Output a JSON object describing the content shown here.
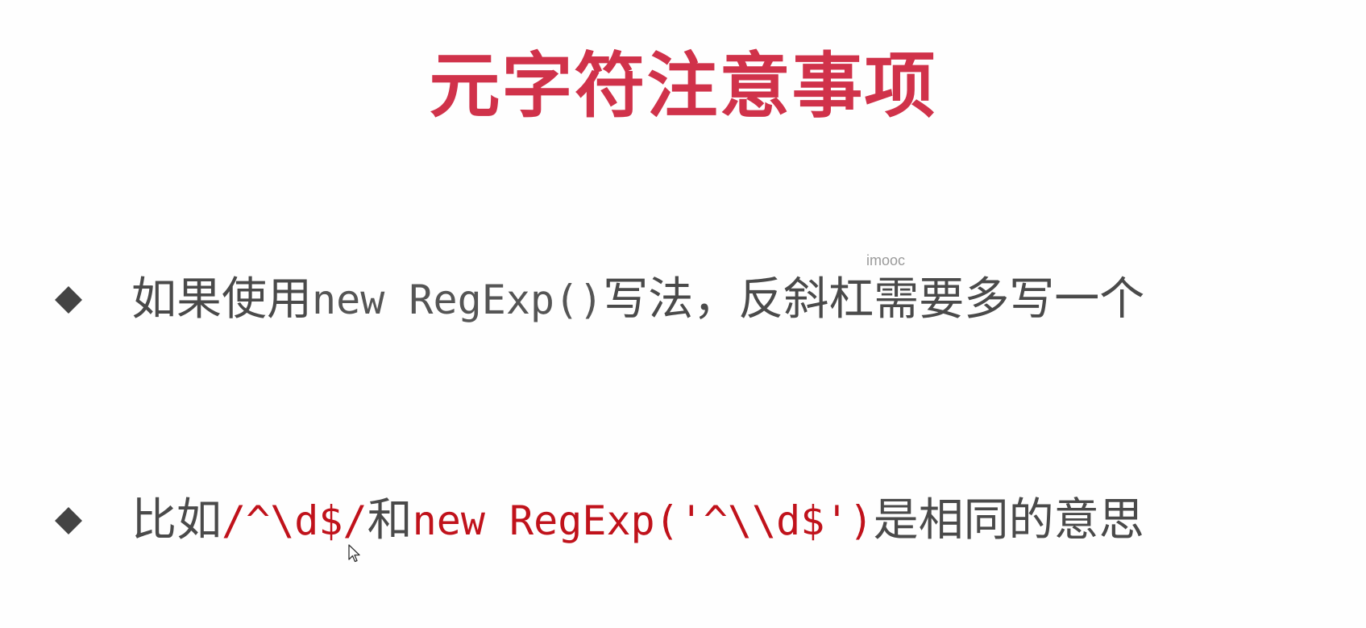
{
  "slide": {
    "title": "元字符注意事项",
    "watermark": "imooc",
    "bullets": [
      {
        "part1": "如果使用",
        "code1": "new RegExp()",
        "part2": "写法，反斜杠需要多写一个"
      },
      {
        "part1": "比如",
        "code1": "/^\\d$/",
        "part2": "和",
        "code2": "new RegExp('^\\\\d$')",
        "part3": "是相同的意思"
      }
    ]
  },
  "colors": {
    "title": "#d0324a",
    "text": "#4a4a4a",
    "code_highlight": "#c0121b",
    "bullet": "#444444"
  },
  "icons": {
    "bullet": "diamond-bullet-icon",
    "cursor": "mouse-pointer-icon"
  }
}
